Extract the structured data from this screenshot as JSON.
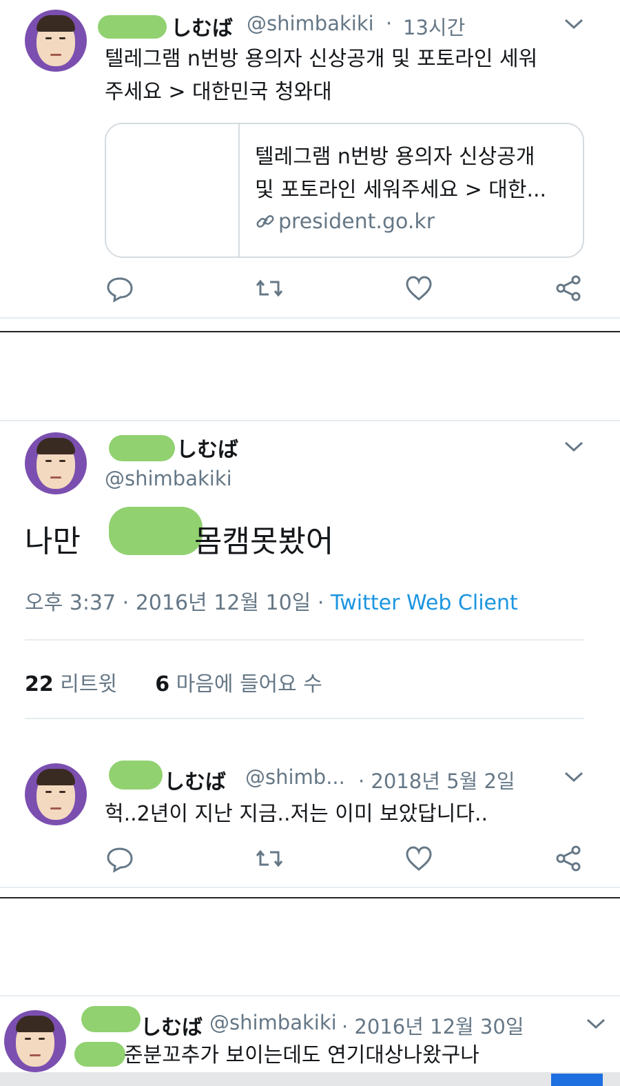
{
  "tweet1": {
    "name": "しむば",
    "handle": "@shimbakiki",
    "time": "13시간",
    "text_line1": "텔레그램 n번방 용의자 신상공개 및 포토라인 세워",
    "text_line2": "주세요 > 대한민국 청와대",
    "card_title_line1": "텔레그램 n번방 용의자 신상공개",
    "card_title_line2": "및 포토라인 세워주세요 > 대한...",
    "card_url": "president.go.kr",
    "icons": [
      "reply-icon",
      "retweet-icon",
      "like-icon",
      "share-icon",
      "chevron-down-icon",
      "link-icon"
    ]
  },
  "tweet2": {
    "name": "しむば",
    "handle": "@shimbakiki",
    "text_left": "나만",
    "text_right": "몸캠못봤어",
    "time": "오후 3:37 · 2016년 12월 10일 ·",
    "client": "Twitter Web Client",
    "retweet_count": "22",
    "retweet_label": "리트윗",
    "like_count": "6",
    "like_label": "마음에 들어요 수"
  },
  "reply": {
    "name": "しむば",
    "handle": "@shimb...",
    "time": "· 2018년 5월 2일",
    "text": "헉..2년이 지난 지금..저는 이미 보았답니다.."
  },
  "tweet3": {
    "name": "しむば",
    "handle": "@shimbakiki",
    "time": "· 2016년 12월 30일",
    "text": "준분꼬추가 보이는데도 연기대상나왔구나"
  },
  "colors": {
    "link": "#1b95e0",
    "muted": "#657786",
    "text": "#14171a",
    "censor_mask": "#8ccf6a",
    "avatar_bg": "#7b4fb0"
  }
}
